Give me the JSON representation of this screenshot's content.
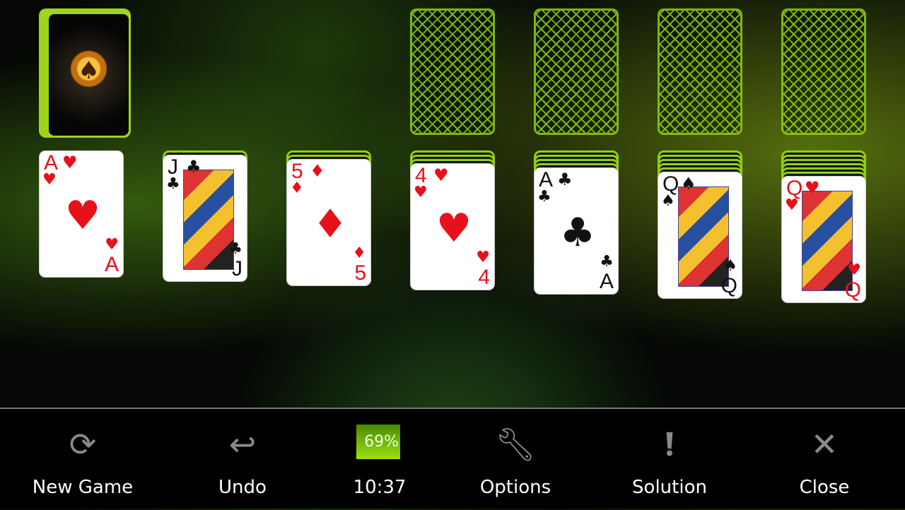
{
  "stock": {
    "icon": "spade-emblem-icon",
    "symbol": "♠"
  },
  "foundations": 4,
  "tableau": [
    {
      "hidden": 0,
      "rank": "A",
      "suit": "♥",
      "color": "red"
    },
    {
      "hidden": 1,
      "rank": "J",
      "suit": "♣",
      "color": "black"
    },
    {
      "hidden": 2,
      "rank": "5",
      "suit": "♦",
      "color": "red"
    },
    {
      "hidden": 3,
      "rank": "4",
      "suit": "♥",
      "color": "red"
    },
    {
      "hidden": 4,
      "rank": "A",
      "suit": "♣",
      "color": "black"
    },
    {
      "hidden": 5,
      "rank": "Q",
      "suit": "♠",
      "color": "black"
    },
    {
      "hidden": 6,
      "rank": "Q",
      "suit": "♥",
      "color": "red"
    }
  ],
  "toolbar": {
    "new_game": {
      "label": "New Game",
      "icon": "refresh-icon"
    },
    "undo": {
      "label": "Undo",
      "icon": "undo-icon"
    },
    "status": {
      "battery": "69%",
      "battery_level": 69,
      "time": "10:37"
    },
    "options": {
      "label": "Options",
      "icon": "wrench-icon"
    },
    "solution": {
      "label": "Solution",
      "icon": "exclamation-bubble-icon"
    },
    "close": {
      "label": "Close",
      "icon": "close-icon"
    }
  },
  "colors": {
    "accent": "#8fd012",
    "red": "#e8101a"
  }
}
